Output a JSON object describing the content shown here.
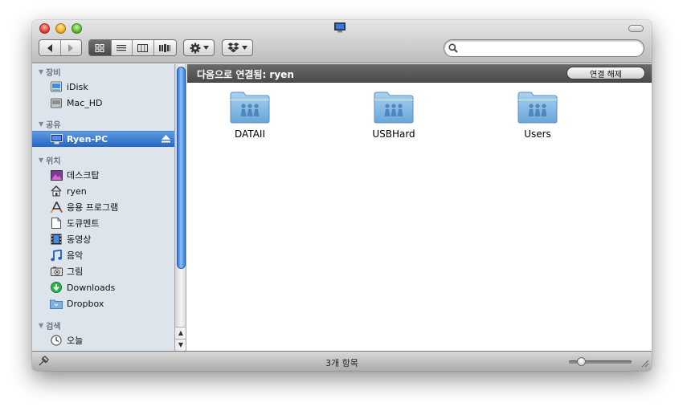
{
  "window": {
    "title_icon": "computer-icon"
  },
  "toolbar": {
    "back_icon": "chevron-left-icon",
    "forward_icon": "chevron-right-icon",
    "view_modes": [
      "icon-view",
      "list-view",
      "column-view",
      "coverflow-view"
    ],
    "active_view": "icon-view",
    "action_icon": "gear-icon",
    "dropbox_icon": "dropbox-icon",
    "search": {
      "value": "",
      "placeholder": ""
    }
  },
  "sidebar": {
    "sections": [
      {
        "header": "장비",
        "items": [
          {
            "label": "iDisk",
            "icon": "idisk-icon"
          },
          {
            "label": "Mac_HD",
            "icon": "harddrive-icon"
          }
        ]
      },
      {
        "header": "공유",
        "items": [
          {
            "label": "Ryen-PC",
            "icon": "computer-icon",
            "selected": true
          }
        ]
      },
      {
        "header": "위치",
        "items": [
          {
            "label": "데스크탑",
            "icon": "desktop-icon"
          },
          {
            "label": "ryen",
            "icon": "home-icon"
          },
          {
            "label": "응용 프로그램",
            "icon": "applications-icon"
          },
          {
            "label": "도큐멘트",
            "icon": "document-icon"
          },
          {
            "label": "동영상",
            "icon": "movies-icon"
          },
          {
            "label": "음악",
            "icon": "music-icon"
          },
          {
            "label": "그림",
            "icon": "pictures-icon"
          },
          {
            "label": "Downloads",
            "icon": "download-icon"
          },
          {
            "label": "Dropbox",
            "icon": "dropbox-folder-icon"
          }
        ]
      },
      {
        "header": "검색",
        "items": [
          {
            "label": "오늘",
            "icon": "clock-icon"
          }
        ]
      }
    ]
  },
  "pathbar": {
    "label": "다음으로 연결됨: ryen",
    "disconnect_label": "연결 해제"
  },
  "folders": [
    {
      "name": "DATAII",
      "icon": "shared-folder-icon"
    },
    {
      "name": "USBHard",
      "icon": "shared-folder-icon"
    },
    {
      "name": "Users",
      "icon": "shared-folder-icon"
    }
  ],
  "status": {
    "item_count": "3개 항목",
    "icon_size_level": 0.15
  },
  "colors": {
    "selection": "#2566c4",
    "sidebar_bg": "#dde4ec",
    "pathbar_bg": "#555555",
    "folder_blue": "#8fc0e6"
  }
}
